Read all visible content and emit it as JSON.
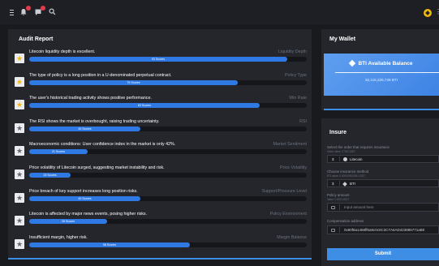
{
  "topbar": {
    "icons": [
      "menu-icon",
      "bell-icon",
      "message-icon",
      "search-icon",
      "coin-icon",
      "more-icon"
    ],
    "more_label": "⋮"
  },
  "audit": {
    "title": "Audit Report",
    "rows": [
      {
        "text": "Litecoin liquidity depth is excellent.",
        "category": "Liquidity Depth",
        "score_label": "93 Scores",
        "score": 93,
        "starred": true
      },
      {
        "text": "The type of policy is a long position in a U-denominated perpetual contract.",
        "category": "Policy Type",
        "score_label": "75 Scores",
        "score": 75,
        "starred": true
      },
      {
        "text": "The user's historical trading activity shows positive performance.",
        "category": "Win Rate",
        "score_label": "83 Scores",
        "score": 83,
        "starred": true
      },
      {
        "text": "The RSI shows the market is overbought, raising trading uncertainty.",
        "category": "RSI",
        "score_label": "40 Scores",
        "score": 40,
        "starred": false
      },
      {
        "text": "Macroeconomic conditions: User confidence index in the market is only 42%.",
        "category": "Market Sentiment",
        "score_label": "21 Scores",
        "score": 21,
        "starred": false
      },
      {
        "text": "Price volatility of Litecoin surged, suggesting market instability and risk.",
        "category": "Price Volatility",
        "score_label": "15 Scores",
        "score": 15,
        "starred": false
      },
      {
        "text": "Price breach of key support increases long position risks.",
        "category": "Support/Pressure Level",
        "score_label": "40 Scores",
        "score": 40,
        "starred": false
      },
      {
        "text": "Litecoin is affected by major news events, posing higher risks.",
        "category": "Policy Environment",
        "score_label": "28 Scores",
        "score": 28,
        "starred": false
      },
      {
        "text": "Insufficient margin, higher risk.",
        "category": "Margin Balance",
        "score_label": "58 Scores",
        "score": 58,
        "starred": false
      }
    ]
  },
  "wallet": {
    "title": "My Wallet",
    "balance_title": "BTI Available Balance",
    "balance_value": "32,115,225,728 BTI"
  },
  "insure": {
    "title": "Insure",
    "order_label": "Select the order that requires insurance",
    "order_sub": "Order value: 2735 USDT",
    "order_value": "Litecoin",
    "method_label": "Choose insurance method",
    "method_sub": "BTI value: 0.00000000256 USDT",
    "method_value": "BTI",
    "amount_label": "Policy amount",
    "amount_sub": "Value: 0.000 USDT",
    "amount_placeholder": "Input amount here",
    "address_label": "Compensation address",
    "address_value": "0x80f8a1468ff6a9c0c0C3C7A6AD423885771aB0",
    "submit_label": "Submit"
  }
}
